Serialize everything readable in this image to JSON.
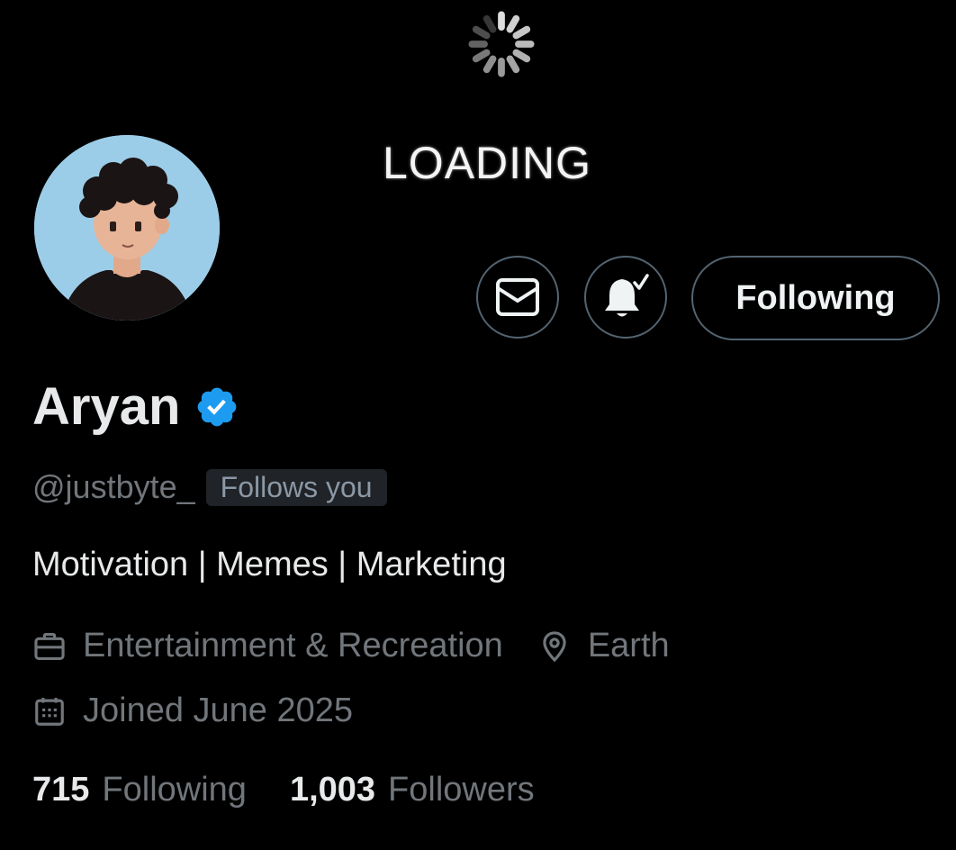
{
  "overlay": {
    "loading_text": "LOADING"
  },
  "profile": {
    "display_name": "Aryan",
    "handle": "@justbyte_",
    "follows_you_badge": "Follows you",
    "bio": "Motivation | Memes | Marketing",
    "category": "Entertainment & Recreation",
    "location": "Earth",
    "joined": "Joined June 2025"
  },
  "actions": {
    "message_icon": "envelope-icon",
    "notifications_icon": "bell-check-icon",
    "follow_label": "Following"
  },
  "stats": {
    "following_count": "715",
    "following_label": "Following",
    "followers_count": "1,003",
    "followers_label": "Followers"
  },
  "colors": {
    "background": "#000000",
    "primary_text": "#e7e9ea",
    "secondary_text": "#71767b",
    "border": "#536471",
    "verified_blue": "#1d9bf0",
    "badge_bg": "#202327"
  }
}
